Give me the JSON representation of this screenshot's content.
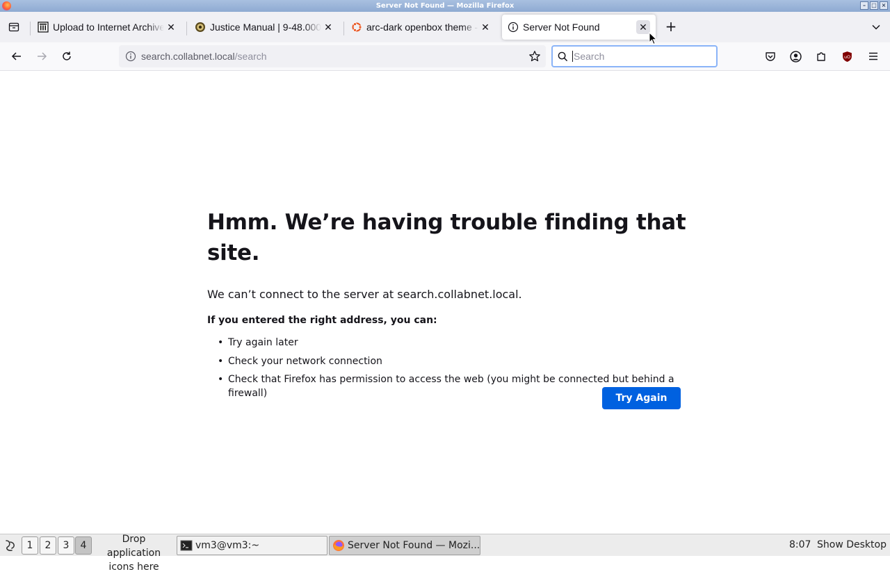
{
  "window": {
    "title": "Server Not Found — Mozilla Firefox"
  },
  "tabs": [
    {
      "label": "Upload to Internet Archive",
      "icon": "internet-archive-icon"
    },
    {
      "label": "Justice Manual | 9-48.000",
      "icon": "doj-seal-icon"
    },
    {
      "label": "arc-dark openbox theme -",
      "icon": "ubuntu-icon"
    },
    {
      "label": "Server Not Found",
      "icon": "info-icon",
      "active": true
    }
  ],
  "navbar": {
    "url_host": "search.collabnet.local",
    "url_path": "/search",
    "search_placeholder": "Search"
  },
  "error_page": {
    "title": "Hmm. We’re having trouble finding that site.",
    "description": "We can’t connect to the server at search.collabnet.local.",
    "hint": "If you entered the right address, you can:",
    "suggestions": [
      "Try again later",
      "Check your network connection",
      "Check that Firefox has permission to access the web (you might be connected but behind a firewall)"
    ],
    "button_label": "Try Again"
  },
  "taskbar": {
    "workspaces": [
      "1",
      "2",
      "3",
      "4"
    ],
    "active_workspace": "4",
    "drop_text": "Drop application icons here",
    "tasks": [
      {
        "label": "vm3@vm3:~",
        "icon": "terminal-icon"
      },
      {
        "label": "Server Not Found — Mozi...",
        "icon": "firefox-icon",
        "active": true
      }
    ],
    "clock": "8:07",
    "show_desktop": "Show Desktop"
  },
  "colors": {
    "accent": "#0061e0",
    "titlebar": "#8eaad2",
    "tabstrip": "#f0f0f4",
    "text": "#15141a",
    "ublock": "#800000"
  }
}
